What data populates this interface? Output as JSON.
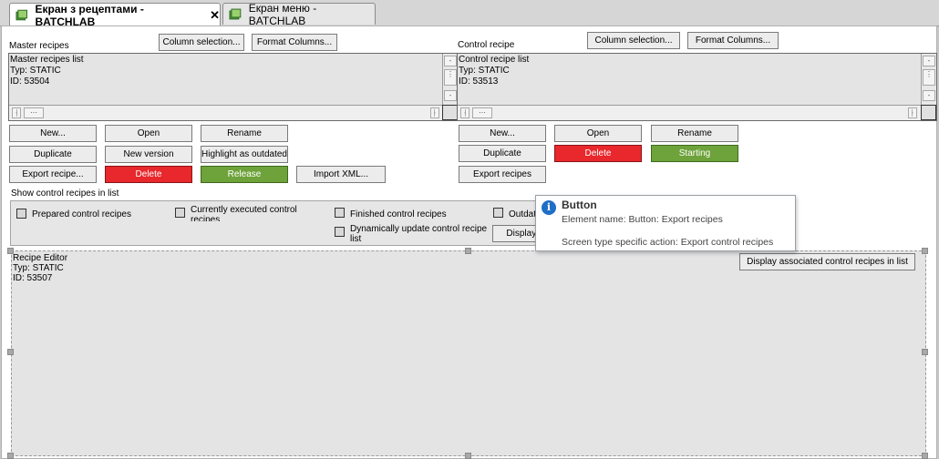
{
  "tabs": [
    {
      "label": "Екран з рецептами - BATCHLAB",
      "close": "✕"
    },
    {
      "label": "Екран меню - BATCHLAB"
    }
  ],
  "master": {
    "title": "Master recipes",
    "column_selection": "Column selection...",
    "format_columns": "Format Columns...",
    "list_lines": [
      "Master recipes list",
      "Typ: STATIC",
      "ID: 53504"
    ],
    "buttons": {
      "new": "New...",
      "open": "Open",
      "rename": "Rename",
      "duplicate": "Duplicate",
      "new_version": "New version",
      "highlight": "Highlight as outdated",
      "export": "Export recipe...",
      "delete": "Delete",
      "release": "Release",
      "import_xml": "Import XML..."
    }
  },
  "control": {
    "title": "Control recipe",
    "column_selection": "Column selection...",
    "format_columns": "Format Columns...",
    "list_lines": [
      "Control recipe list",
      "Typ: STATIC",
      "ID: 53513"
    ],
    "buttons": {
      "new": "New...",
      "open": "Open",
      "rename": "Rename",
      "duplicate": "Duplicate",
      "delete": "Delete",
      "starting": "Starting",
      "export": "Export recipes"
    }
  },
  "filter": {
    "title": "Show control recipes in list",
    "prepared": "Prepared control recipes",
    "executing": "Currently executed control recipes",
    "finished": "Finished control recipes",
    "outdated": "Outdate",
    "dynamic": "Dynamically update control recipe list",
    "display_button": "Display a"
  },
  "editor": {
    "lines": [
      "Recipe Editor",
      "Typ: STATIC",
      "ID: 53507"
    ],
    "display_assoc": "Display associated control recipes in list"
  },
  "tooltip": {
    "title": "Button",
    "element_name": "Element name: Button: Export recipes",
    "action": "Screen type specific action: Export control recipes"
  },
  "colors": {
    "red_button": "#e8282c",
    "green_button": "#6ea23a",
    "info_icon": "#1e6fc5"
  }
}
